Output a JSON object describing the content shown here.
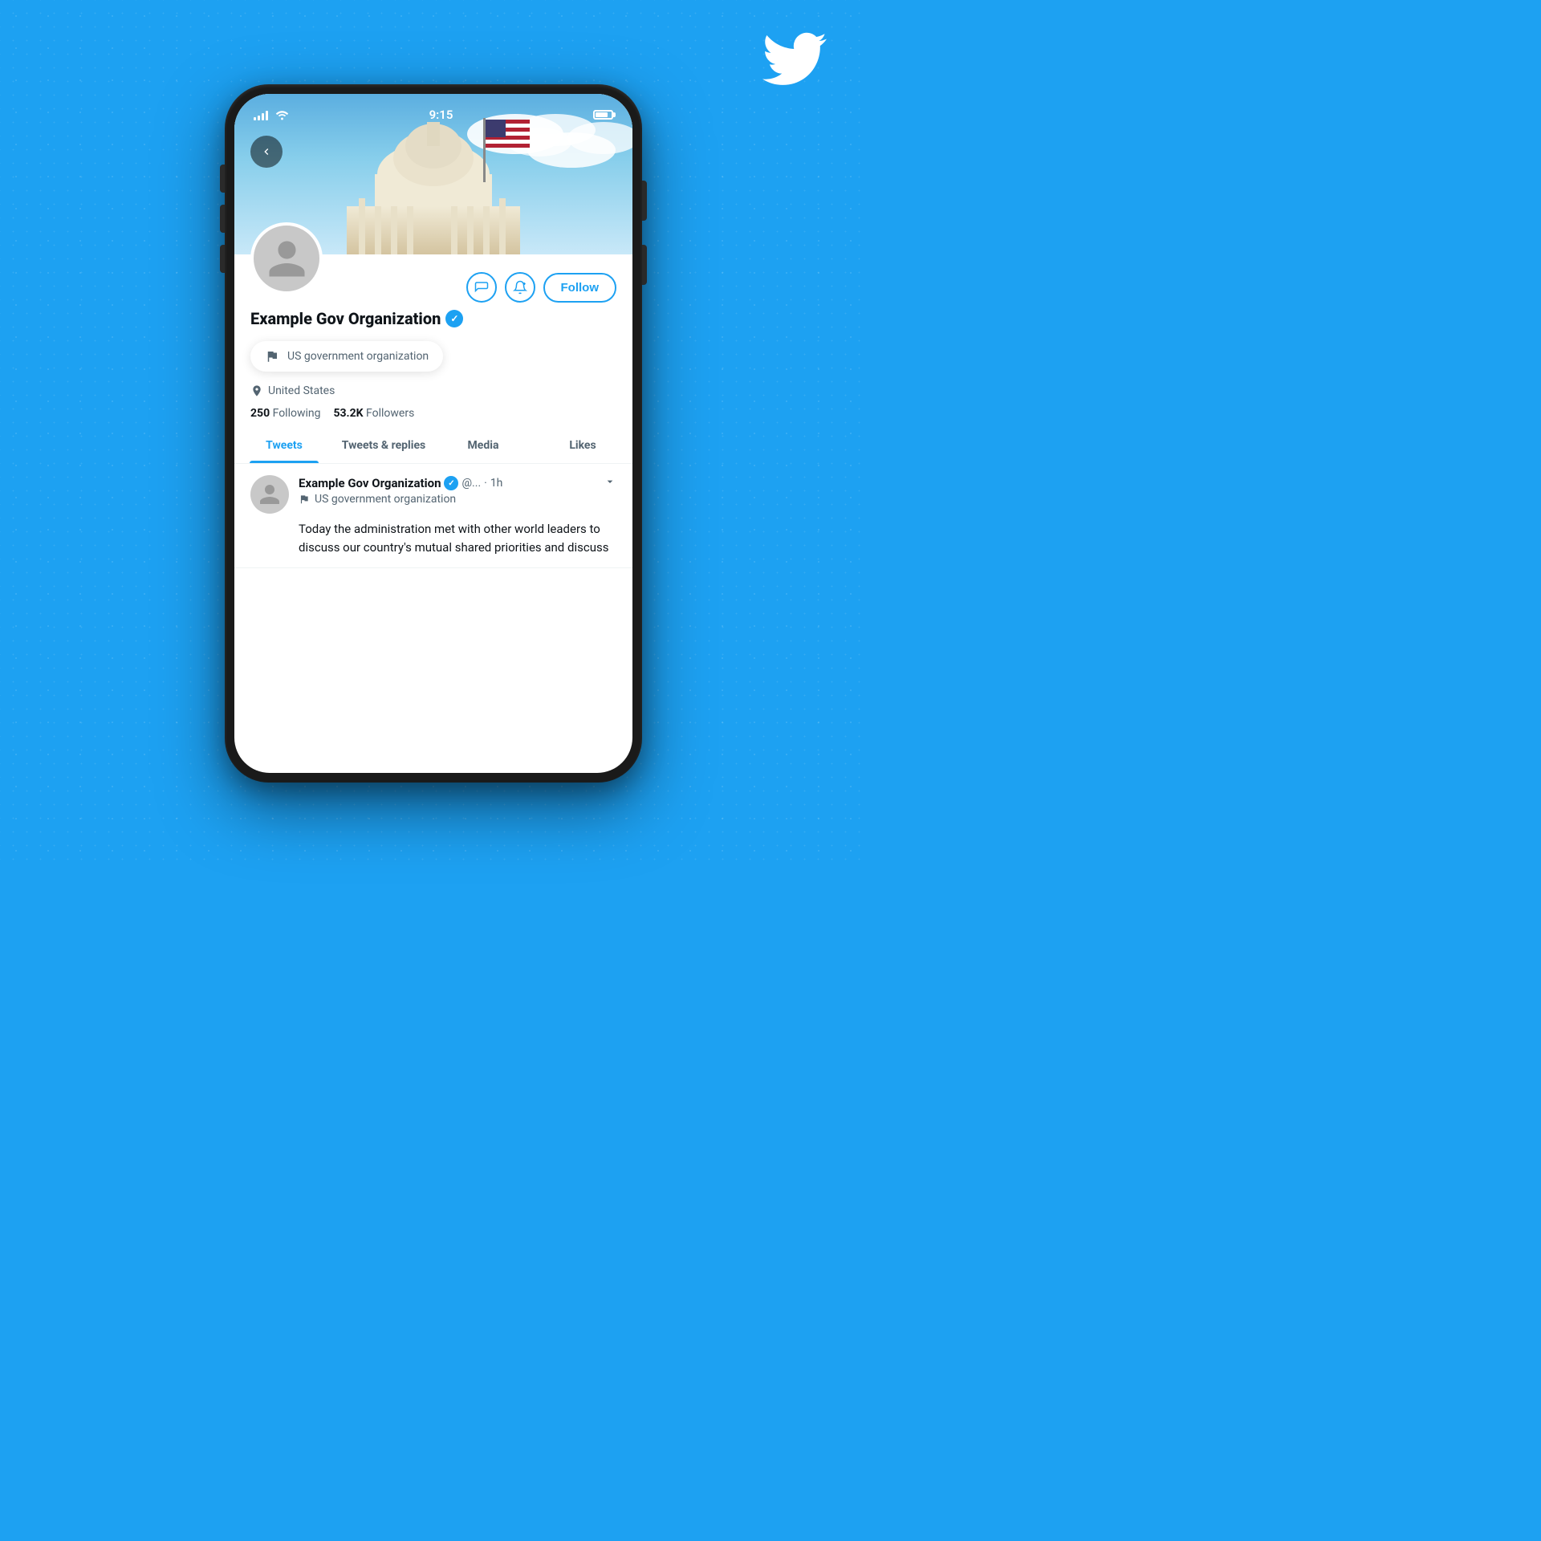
{
  "background": {
    "color": "#1DA1F2"
  },
  "twitter_logo": {
    "label": "Twitter Bird Logo"
  },
  "status_bar": {
    "time": "9:15",
    "signal": "signal-icon",
    "wifi": "wifi-icon",
    "battery": "battery-icon"
  },
  "phone": {
    "header_image_alt": "US Capitol building with American flag"
  },
  "back_button": {
    "label": "‹"
  },
  "profile": {
    "name": "Example Gov Organization",
    "verified": true,
    "verified_label": "✓",
    "gov_type": "US government organization",
    "location": "United States",
    "following_count": "250",
    "following_label": "Following",
    "followers_count": "53.2K",
    "followers_label": "Followers"
  },
  "action_buttons": {
    "message_label": "Message",
    "notify_label": "Notifications",
    "follow_label": "Follow"
  },
  "tabs": [
    {
      "label": "Tweets",
      "active": true
    },
    {
      "label": "Tweets & replies",
      "active": false
    },
    {
      "label": "Media",
      "active": false
    },
    {
      "label": "Likes",
      "active": false
    }
  ],
  "tweet": {
    "author_name": "Example Gov Organization",
    "verified_label": "✓",
    "handle": "@...",
    "time": "1h",
    "gov_label": "US government organization",
    "body": "Today the administration met with other world leaders to discuss our country's mutual shared priorities and discuss"
  }
}
